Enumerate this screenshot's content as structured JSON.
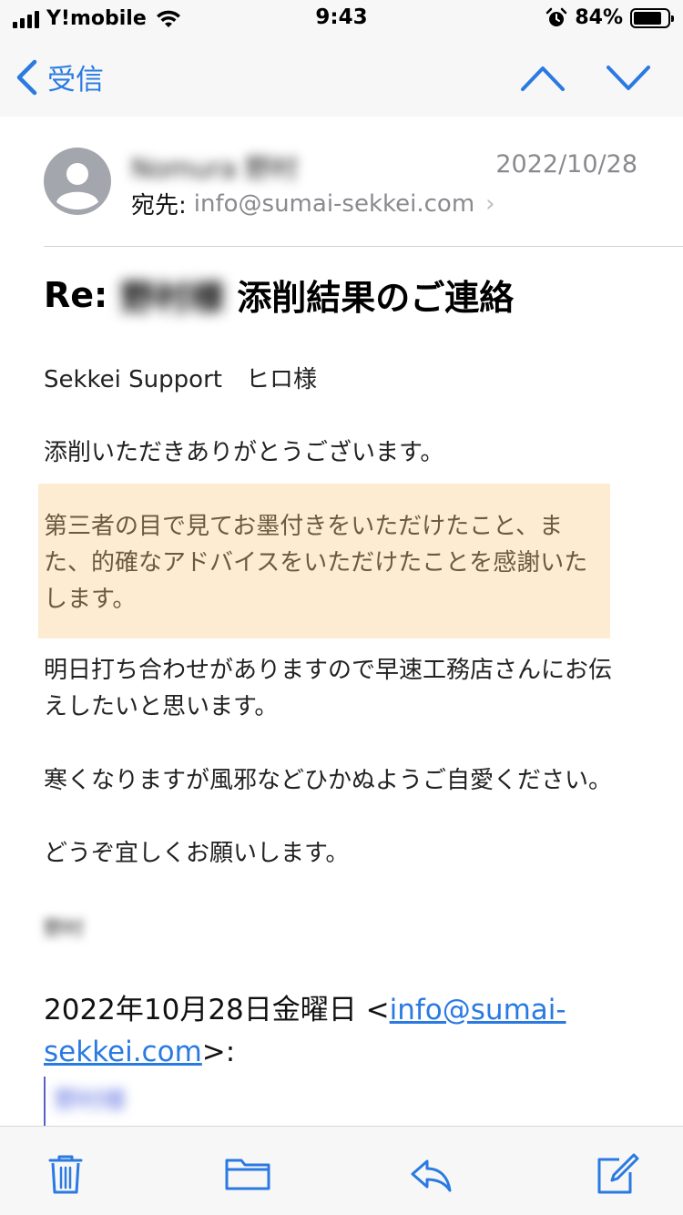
{
  "status_bar": {
    "carrier": "Y!mobile",
    "time": "9:43",
    "battery_percent": "84%",
    "battery_level": 0.84
  },
  "nav": {
    "back_label": "受信",
    "up_icon": "chevron-up-icon",
    "down_icon": "chevron-down-icon"
  },
  "message": {
    "sender_name": "Nomura 野村",
    "date": "2022/10/28",
    "to_label": "宛先:",
    "to_address": "info@sumai-sekkei.com",
    "subject_prefix": "Re:",
    "subject_blurred": "野村様",
    "subject_rest": "添削結果のご連絡"
  },
  "body": {
    "greeting": "Sekkei Support　ヒロ様",
    "para1": "添削いただきありがとうございます。",
    "highlight": "第三者の目で見てお墨付きをいただけたこと、また、的確なアドバイスをいただけたことを感謝いたします。",
    "para3": "明日打ち合わせがありますので早速工務店さんにお伝えしたいと思います。",
    "para4": "寒くなりますが風邪などひかぬようご自愛ください。",
    "para5": "どうぞ宜しくお願いします。",
    "signature": "野村",
    "quote_date": "2022年10月28日金曜日 <",
    "quote_email": "info@sumai-sekkei.com",
    "quote_suffix": ">:",
    "quote_blurred": "野村様"
  },
  "toolbar": {
    "items": [
      "trash-icon",
      "folder-icon",
      "reply-icon",
      "compose-icon"
    ]
  },
  "colors": {
    "accent": "#2a7ae2",
    "highlight_bg": "#fdebd2",
    "secondary_text": "#8a8a8f"
  }
}
